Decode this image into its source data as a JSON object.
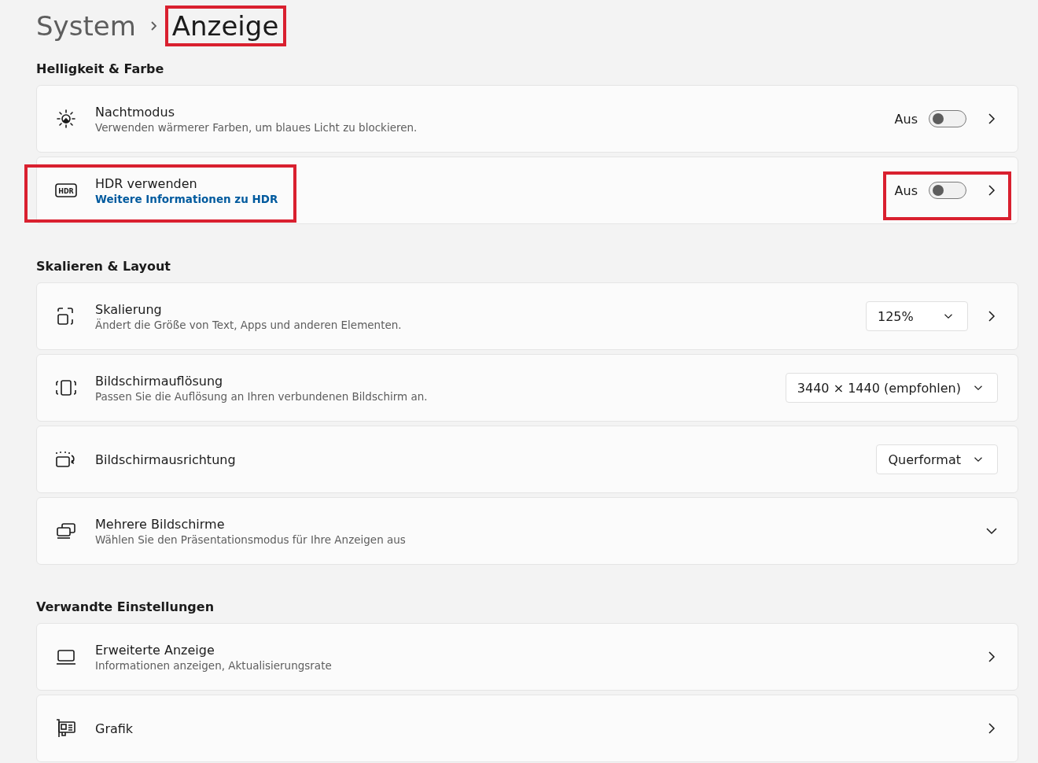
{
  "breadcrumb": [
    {
      "label": "System",
      "current": false,
      "highlighted": false
    },
    {
      "label": "Anzeige",
      "current": true,
      "highlighted": true
    }
  ],
  "sections": [
    {
      "heading": "Helligkeit & Farbe",
      "rows": [
        {
          "kind": "toggle",
          "title": "Nachtmodus",
          "subtitle": "Verwenden wärmerer Farben, um blaues Licht zu blockieren.",
          "state_label": "Aus",
          "on": false,
          "chevron": true
        },
        {
          "kind": "toggle",
          "icon_text": "HDR",
          "title": "HDR verwenden",
          "link": "Weitere Informationen zu HDR",
          "state_label": "Aus",
          "on": false,
          "chevron": true,
          "highlight_text": true,
          "highlight_control": true
        }
      ]
    },
    {
      "heading": "Skalieren & Layout",
      "rows": [
        {
          "kind": "dropdown",
          "title": "Skalierung",
          "subtitle": "Ändert die Größe von Text, Apps und anderen Elementen.",
          "value": "125%",
          "chevron": true
        },
        {
          "kind": "dropdown",
          "title": "Bildschirmauflösung",
          "subtitle": "Passen Sie die Auflösung an Ihren verbundenen Bildschirm an.",
          "value": "3440 × 1440 (empfohlen)"
        },
        {
          "kind": "dropdown",
          "title": "Bildschirmausrichtung",
          "value": "Querformat"
        },
        {
          "kind": "expander",
          "title": "Mehrere Bildschirme",
          "subtitle": "Wählen Sie den Präsentationsmodus für Ihre Anzeigen aus",
          "chevron": true
        }
      ]
    },
    {
      "heading": "Verwandte Einstellungen",
      "rows": [
        {
          "kind": "link",
          "title": "Erweiterte Anzeige",
          "subtitle": "Informationen anzeigen, Aktualisierungsrate",
          "chevron": true
        },
        {
          "kind": "link",
          "title": "Grafik",
          "chevron": true
        }
      ]
    }
  ]
}
